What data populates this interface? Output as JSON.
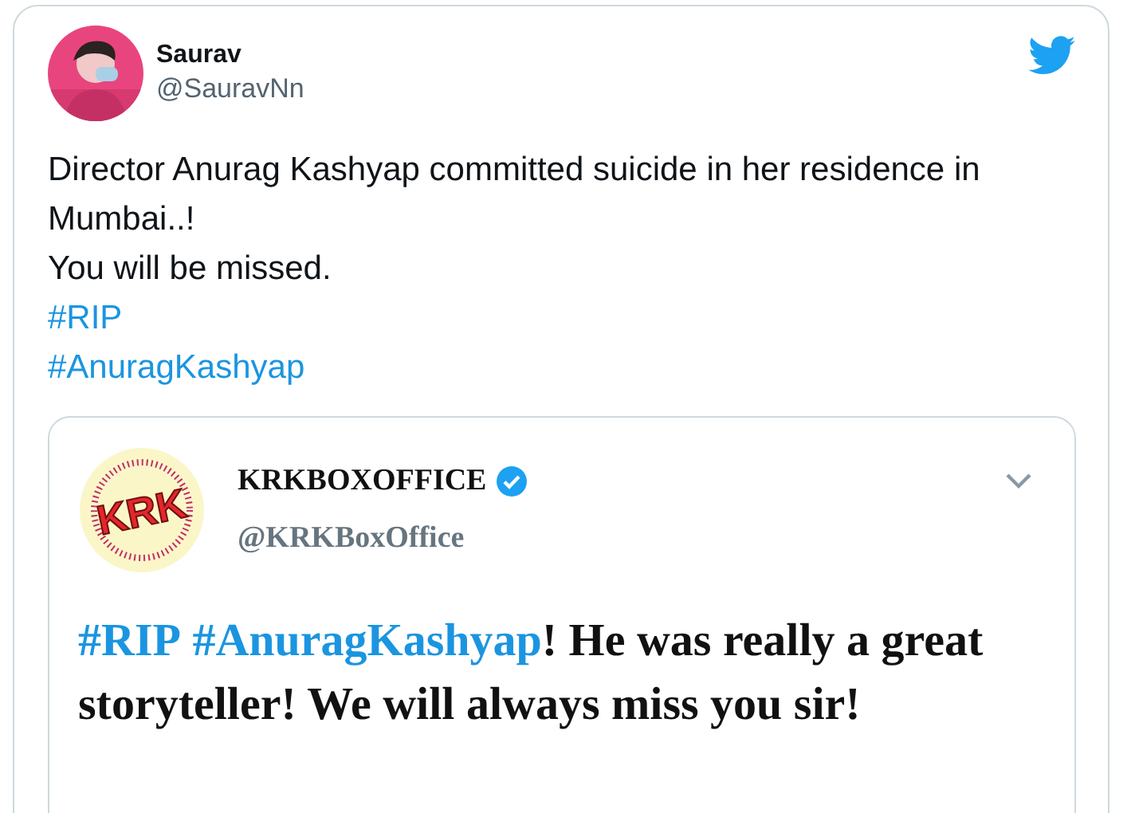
{
  "tweet": {
    "author": {
      "name": "Saurav",
      "handle": "@SauravNn"
    },
    "lines": [
      {
        "kind": "text",
        "text": "Director Anurag Kashyap committed suicide in her residence in Mumbai..!"
      },
      {
        "kind": "text",
        "text": "You will be missed."
      },
      {
        "kind": "hashtag",
        "text": "#RIP"
      },
      {
        "kind": "hashtag",
        "text": "#AnuragKashyap"
      }
    ],
    "quote": {
      "logo_text": "KRK",
      "name": "KRKBOXOFFICE",
      "verified": true,
      "handle": "@KRKBoxOffice",
      "parts": [
        {
          "kind": "hashtag",
          "text": "#RIP"
        },
        {
          "kind": "hashtag",
          "text": "#AnuragKashyap"
        },
        {
          "kind": "text",
          "text": "! He was really a great storyteller! We will always miss you sir!"
        }
      ]
    }
  }
}
